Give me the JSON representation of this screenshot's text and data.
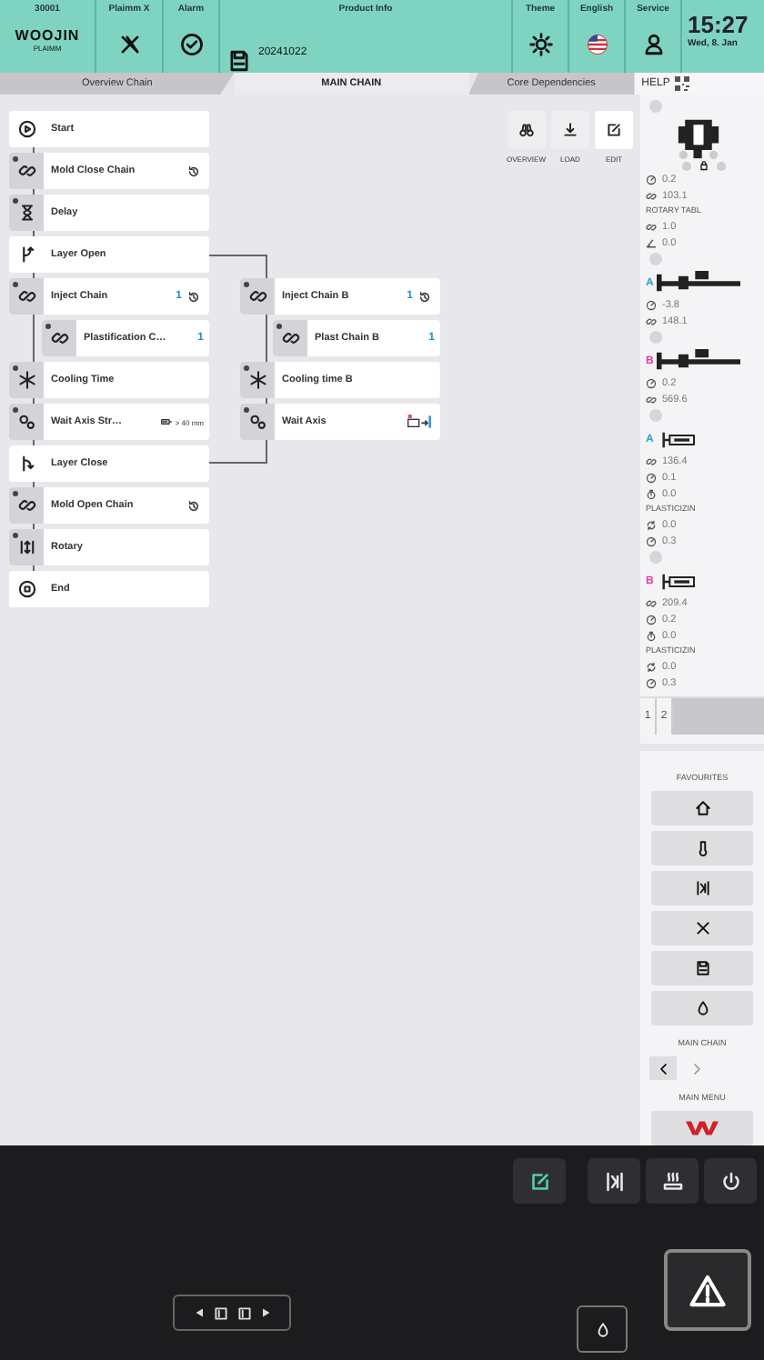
{
  "header": {
    "station": "30001",
    "logo": "WOOJIN",
    "logo_sub": "PLAIMM",
    "buttons": [
      {
        "label": "Plaimm X",
        "kind": "x-logo"
      },
      {
        "label": "Alarm",
        "kind": "check"
      }
    ],
    "product": {
      "label": "Product Info",
      "value": "20241022"
    },
    "settings": [
      {
        "label": "Theme",
        "kind": "sun"
      },
      {
        "label": "English",
        "kind": "flag"
      },
      {
        "label": "Service",
        "kind": "person"
      }
    ],
    "time": "15:27",
    "date": "Wed, 8. Jan"
  },
  "tabs": [
    {
      "label": "Overview Chain",
      "selected": false
    },
    {
      "label": "MAIN CHAIN",
      "selected": true
    },
    {
      "label": "Core Dependencies",
      "selected": false
    }
  ],
  "help": "HELP",
  "toolbar": [
    {
      "label": "OVERVIEW",
      "kind": "binoculars"
    },
    {
      "label": "LOAD",
      "kind": "download"
    },
    {
      "label": "EDIT",
      "kind": "edit"
    }
  ],
  "chain": {
    "steps": [
      {
        "kind": "start",
        "label": "Start",
        "repeat": false
      },
      {
        "kind": "link",
        "label": "Mold Close Chain",
        "repeat": true
      },
      {
        "kind": "hourglass",
        "label": "Delay",
        "repeat": false
      },
      {
        "kind": "split",
        "label": "Layer Open",
        "repeat": false,
        "parallel": [
          {
            "kind": "link",
            "label": "Inject Chain B",
            "count": "1",
            "repeat": true,
            "children": [
              {
                "kind": "link",
                "label": "Plast Chain B",
                "count": "1",
                "repeat": false
              }
            ]
          },
          {
            "kind": "snowflake",
            "label": "Cooling time B",
            "repeat": false
          },
          {
            "kind": "axis",
            "label": "Wait Axis",
            "repeat": false,
            "signal": true
          }
        ]
      },
      {
        "kind": "link",
        "label": "Inject Chain",
        "count": "1",
        "repeat": true,
        "children": [
          {
            "kind": "link",
            "label": "Plastification C…",
            "count": "1",
            "repeat": false
          }
        ]
      },
      {
        "kind": "snowflake",
        "label": "Cooling Time",
        "repeat": false
      },
      {
        "kind": "axis",
        "label": "Wait Axis Str…",
        "condition": "> 40 mm",
        "repeat": false
      },
      {
        "kind": "merge",
        "label": "Layer Close",
        "repeat": false
      },
      {
        "kind": "link",
        "label": "Mold Open Chain",
        "repeat": true
      },
      {
        "kind": "rotary",
        "label": "Rotary",
        "repeat": false
      },
      {
        "kind": "end",
        "label": "End",
        "repeat": false
      }
    ]
  },
  "panel": {
    "items": [
      {
        "kind": "dot"
      },
      {
        "kind": "mold"
      },
      {
        "kind": "gauge",
        "value": "0.2"
      },
      {
        "kind": "link",
        "value": "103.1"
      },
      {
        "kind": "heading",
        "text": "ROTARY TABL"
      },
      {
        "kind": "link",
        "value": "1.0"
      },
      {
        "kind": "angle",
        "value": "0.0"
      },
      {
        "kind": "dot"
      },
      {
        "kind": "unit",
        "tag": "A",
        "color": "#3a9ad9"
      },
      {
        "kind": "gauge",
        "value": "-3.8"
      },
      {
        "kind": "link",
        "value": "148.1"
      },
      {
        "kind": "dot"
      },
      {
        "kind": "unit",
        "tag": "B",
        "color": "#e0409c"
      },
      {
        "kind": "gauge",
        "value": "0.2"
      },
      {
        "kind": "link",
        "value": "569.6"
      },
      {
        "kind": "dot"
      },
      {
        "kind": "inject",
        "tag": "A",
        "color": "#3a9ad9"
      },
      {
        "kind": "link",
        "value": "136.4"
      },
      {
        "kind": "gauge",
        "value": "0.1"
      },
      {
        "kind": "timer",
        "value": "0.0"
      },
      {
        "kind": "heading",
        "text": "PLASTICIZIN"
      },
      {
        "kind": "rotate",
        "value": "0.0"
      },
      {
        "kind": "gauge",
        "value": "0.3"
      },
      {
        "kind": "dot"
      },
      {
        "kind": "inject",
        "tag": "B",
        "color": "#e0409c"
      },
      {
        "kind": "link",
        "value": "209.4"
      },
      {
        "kind": "gauge",
        "value": "0.2"
      },
      {
        "kind": "timer",
        "value": "0.0"
      },
      {
        "kind": "heading",
        "text": "PLASTICIZIN"
      },
      {
        "kind": "rotate",
        "value": "0.0"
      },
      {
        "kind": "gauge",
        "value": "0.3"
      }
    ],
    "pages": [
      {
        "label": "1"
      },
      {
        "label": "2"
      }
    ],
    "favourites_label": "FAVOURITES",
    "favourites": [
      {
        "kind": "home"
      },
      {
        "kind": "thermometer"
      },
      {
        "kind": "door"
      },
      {
        "kind": "tools"
      },
      {
        "kind": "save"
      },
      {
        "kind": "drop"
      }
    ],
    "main_chain_label": "MAIN CHAIN",
    "main_menu_label": "MAIN MENU"
  },
  "bottom": {
    "toolbar": [
      {
        "kind": "edit",
        "active": true
      },
      {
        "kind": "door",
        "active": false
      },
      {
        "kind": "heater",
        "active": false
      },
      {
        "kind": "power",
        "active": false
      }
    ]
  }
}
